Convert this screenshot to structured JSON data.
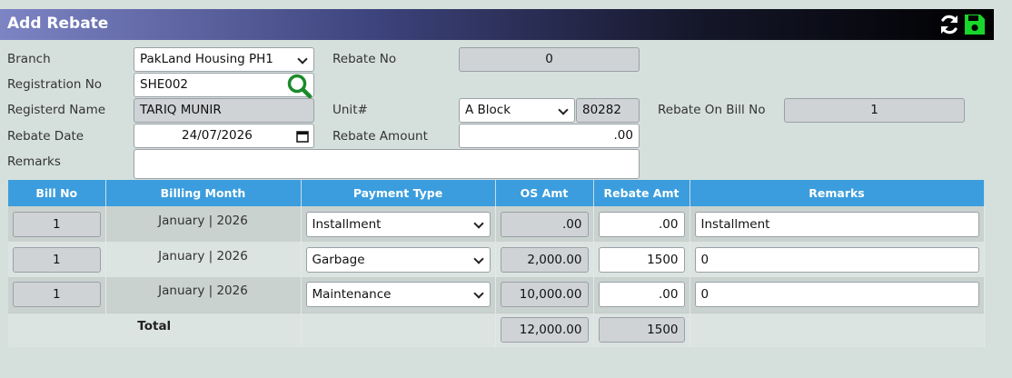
{
  "header": {
    "title": "Add Rebate",
    "refresh_icon": "refresh-icon",
    "save_icon": "floppy-disk-icon",
    "refresh_color": "#ffffff",
    "save_color": "#19d62a"
  },
  "form": {
    "branch_label": "Branch",
    "branch_value": "PakLand Housing PH1",
    "rebate_no_label": "Rebate No",
    "rebate_no_value": "0",
    "registration_no_label": "Registration No",
    "registration_no_value": "SHE002",
    "registered_name_label": "Registerd Name",
    "registered_name_value": "TARIQ MUNIR",
    "unit_label": "Unit#",
    "unit_block_value": "A Block",
    "unit_number_value": "80282",
    "rebate_on_bill_no_label": "Rebate On Bill No",
    "rebate_on_bill_no_value": "1",
    "rebate_date_label": "Rebate Date",
    "rebate_date_value": "24/07/2026",
    "rebate_amount_label": "Rebate Amount",
    "rebate_amount_value": ".00",
    "remarks_label": "Remarks",
    "remarks_value": ""
  },
  "table": {
    "headers": [
      "Bill No",
      "Billing Month",
      "Payment Type",
      "OS Amt",
      "Rebate Amt",
      "Remarks"
    ],
    "rows": [
      {
        "bill_no": "1",
        "billing_month": "January | 2026",
        "payment_type": "Installment",
        "os_amt": ".00",
        "rebate_amt": ".00",
        "remarks": "Installment"
      },
      {
        "bill_no": "1",
        "billing_month": "January | 2026",
        "payment_type": "Garbage",
        "os_amt": "2,000.00",
        "rebate_amt": "1500",
        "remarks": "0"
      },
      {
        "bill_no": "1",
        "billing_month": "January | 2026",
        "payment_type": "Maintenance",
        "os_amt": "10,000.00",
        "rebate_amt": ".00",
        "remarks": "0"
      }
    ],
    "total": {
      "label": "Total",
      "os_amt": "12,000.00",
      "rebate_amt": "1500"
    }
  },
  "colors": {
    "page_background": "#d5e0dc",
    "table_header": "#3b9ddd",
    "search_icon": "#1a8a2a"
  }
}
